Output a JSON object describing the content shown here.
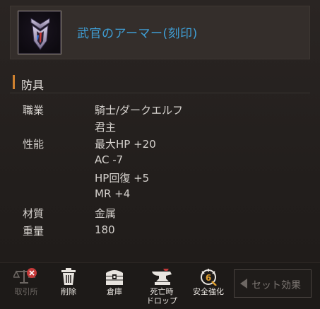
{
  "item": {
    "name": "武官のアーマー(刻印)",
    "icon": "armor-emblem-icon",
    "name_color": "#3f9fd6"
  },
  "category": "防具",
  "stats": [
    {
      "label": "職業",
      "values": [
        "騎士/ダークエルフ",
        "君主"
      ]
    },
    {
      "label": "性能",
      "values": [
        "最大HP  +20",
        "AC  -7",
        "HP回復  +5",
        "MR  +4"
      ]
    },
    {
      "label": "材質",
      "values": [
        "金属"
      ]
    },
    {
      "label": "重量",
      "values": [
        "180"
      ]
    }
  ],
  "toolbar": {
    "exchange": {
      "label": "取引所",
      "icon": "scales-disabled-icon",
      "enabled": false
    },
    "delete": {
      "label": "削除",
      "icon": "trash-icon"
    },
    "storage": {
      "label": "倉庫",
      "icon": "chest-icon"
    },
    "death_drop": {
      "label_line1": "死亡時",
      "label_line2": "ドロップ",
      "icon": "anvil-icon"
    },
    "safe_enhance": {
      "label": "安全強化",
      "icon": "enhance-6-icon",
      "badge": "6"
    },
    "set_effect": {
      "label": "セット効果",
      "icon": "arrow-left-icon"
    }
  },
  "colors": {
    "accent": "#d0822f",
    "item_name": "#3f9fd6",
    "disabled": "#6c6662"
  }
}
